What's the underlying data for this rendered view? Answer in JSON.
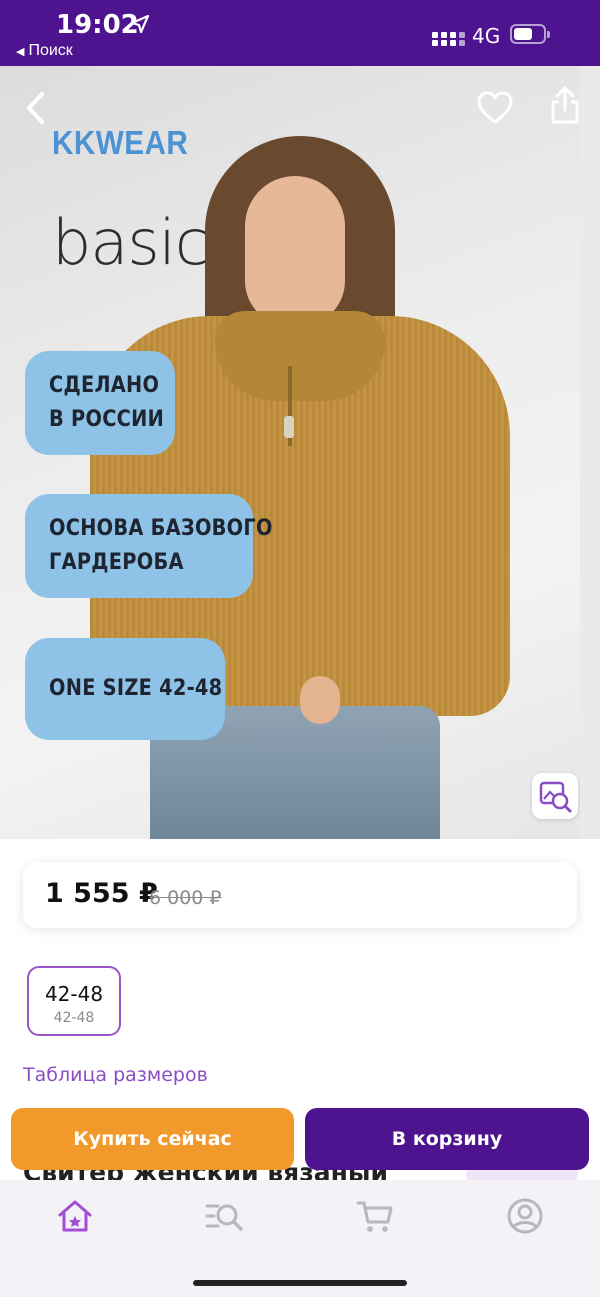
{
  "status_bar": {
    "time": "19:02",
    "back_label": "Поиск",
    "network": "4G"
  },
  "hero": {
    "brand": "KKWEAR",
    "line_title": "basic",
    "badges": [
      {
        "line1": "СДЕЛАНО",
        "line2": "В РОССИИ"
      },
      {
        "line1": "ОСНОВА БАЗОВОГО",
        "line2": "ГАРДЕРОБА"
      },
      {
        "line1": "ONE SIZE 42-48",
        "line2": ""
      }
    ],
    "icons": {
      "back": "chevron-left-icon",
      "favorite": "heart-icon",
      "share": "share-icon",
      "visual_search": "image-search-icon"
    }
  },
  "price": {
    "current": "1 555 ₽",
    "old": "6 000 ₽"
  },
  "sizes": {
    "selected": {
      "label": "42-48",
      "sub": "42-48"
    },
    "table_link": "Таблица размеров"
  },
  "product": {
    "title": "Свитер женский вязаный"
  },
  "actions": {
    "buy_now": "Купить сейчас",
    "add_to_cart": "В корзину"
  },
  "tabbar": {
    "items": [
      "home-icon",
      "catalog-search-icon",
      "cart-icon",
      "profile-icon"
    ],
    "active_color": "#a24fd6",
    "inactive_color": "#b9b5c2"
  },
  "colors": {
    "brand_purple": "#4e1490",
    "buy_orange": "#f19a2b",
    "badge_blue": "#8ec2e6",
    "link_purple": "#8b4ec2"
  }
}
